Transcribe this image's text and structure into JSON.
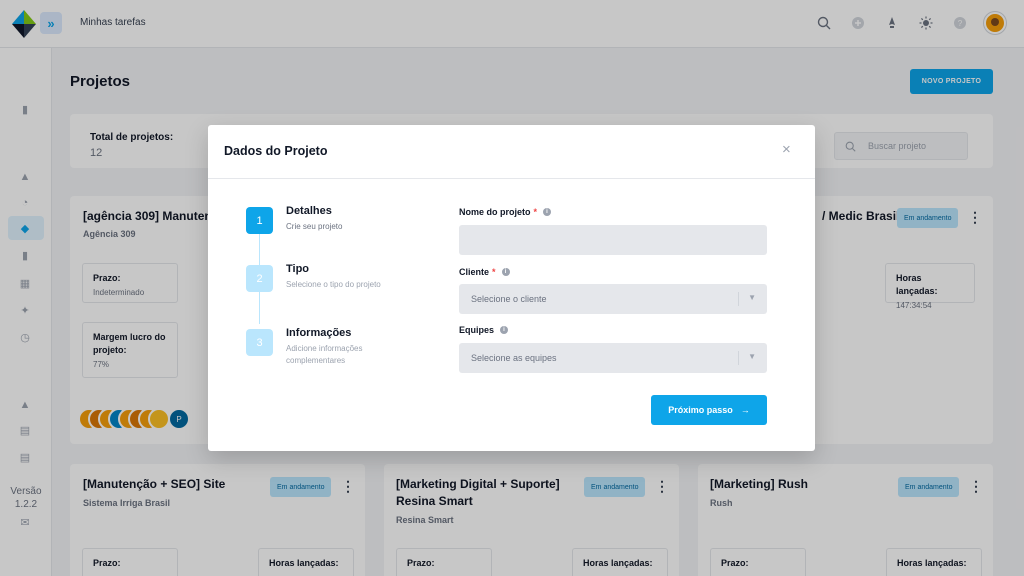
{
  "topbar": {
    "page_label": "Minhas tarefas",
    "icons": [
      "search-icon",
      "plus-icon",
      "rocket-icon",
      "sun-icon",
      "help-icon"
    ]
  },
  "sidebar": {
    "version_label": "Versão",
    "version_number": "1.2.2"
  },
  "page": {
    "title": "Projetos",
    "new_project_button": "NOVO PROJETO",
    "summary_label": "Total de projetos:",
    "summary_value": "12",
    "search_placeholder": "Buscar projeto"
  },
  "cards": [
    {
      "title": "[agência 309] Manutenç",
      "client": "Agência 309",
      "deadline_label": "Prazo:",
      "deadline_value": "Indeterminado",
      "margin_label": "Margem lucro do projeto:",
      "margin_value": "77%",
      "avatar_initial": "P"
    },
    {
      "title": "/ Medic Brasil",
      "badge": "Em andamento",
      "hours_label": "Horas lançadas:",
      "hours_value": "147:34:54"
    },
    {
      "title": "[Manutenção + SEO] Site",
      "client": "Sistema Irriga Brasil",
      "badge": "Em andamento",
      "deadline_label": "Prazo:",
      "hours_label": "Horas lançadas:"
    },
    {
      "title": "[Marketing Digital + Suporte] Resina Smart",
      "client": "Resina Smart",
      "badge": "Em andamento",
      "deadline_label": "Prazo:",
      "hours_label": "Horas lançadas:"
    },
    {
      "title": "[Marketing] Rush",
      "client": "Rush",
      "badge": "Em andamento",
      "deadline_label": "Prazo:",
      "hours_label": "Horas lançadas:"
    }
  ],
  "modal": {
    "title": "Dados do Projeto",
    "close_glyph": "×",
    "steps": [
      {
        "number": "1",
        "title": "Detalhes",
        "description": "Crie seu projeto"
      },
      {
        "number": "2",
        "title": "Tipo",
        "description": "Selecione o tipo do projeto"
      },
      {
        "number": "3",
        "title": "Informações",
        "description": "Adicione informações complementares"
      }
    ],
    "fields": {
      "name_label": "Nome do projeto",
      "name_value": "",
      "client_label": "Cliente",
      "client_placeholder": "Selecione o cliente",
      "teams_label": "Equipes",
      "teams_placeholder": "Selecione as equipes",
      "required_mark": "*"
    },
    "next_button": "Próximo passo",
    "next_arrow": "→"
  },
  "colors": {
    "accent": "#0ea5e9",
    "badge_bg": "#bae6fd",
    "required": "#ef4444"
  }
}
